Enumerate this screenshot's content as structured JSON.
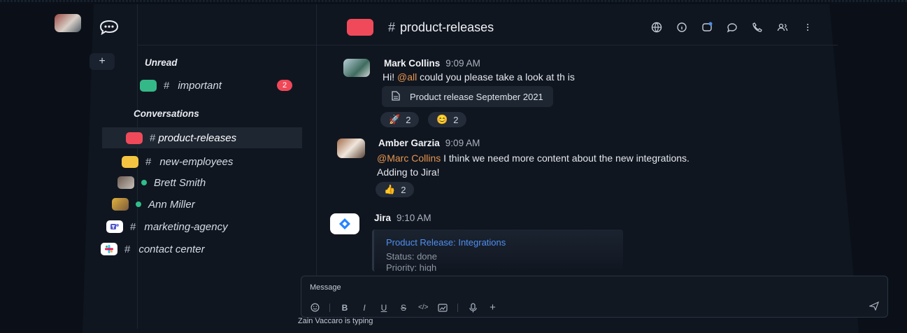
{
  "colors": {
    "accent_red": "#f04a5a",
    "accent_green": "#2fbf8a",
    "accent_yellow": "#f5c542",
    "mention": "#e7954d",
    "link_blue": "#4f8ff0"
  },
  "rail": {
    "logo_icon": "chat-bubble-icon",
    "add_label": "+"
  },
  "sidebar": {
    "unread_title": "Unread",
    "unread": [
      {
        "label": "important",
        "prefix": "#",
        "badge": "2",
        "color": "#35b887"
      }
    ],
    "conversations_title": "Conversations",
    "conversations": [
      {
        "label": "product-releases",
        "prefix": "#",
        "color": "#f04a5a",
        "active": true
      },
      {
        "label": "new-employees",
        "prefix": "#",
        "color": "#f5c542"
      },
      {
        "label": "Brett Smith",
        "status": "online"
      },
      {
        "label": "Ann Miller",
        "status": "online"
      },
      {
        "label": "marketing-agency",
        "prefix": "#",
        "icon": "teams-icon"
      },
      {
        "label": "contact center",
        "prefix": "#",
        "icon": "slack-icon"
      }
    ]
  },
  "header": {
    "channel_prefix": "#",
    "channel": "product-releases",
    "icons": [
      "globe-icon",
      "info-icon",
      "notification-icon",
      "discussion-icon",
      "phone-icon",
      "members-icon",
      "kebab-icon"
    ]
  },
  "messages": [
    {
      "author": "Mark Collins",
      "time": "9:09 AM",
      "text_before": "Hi! ",
      "mention": "@all",
      "text_after": " could you please take a look at th is",
      "file": "Product release September 2021",
      "reactions": [
        {
          "emoji": "🚀",
          "count": "2"
        },
        {
          "emoji": "😊",
          "count": "2"
        }
      ]
    },
    {
      "author": "Amber Garzia",
      "time": "9:09 AM",
      "mention": "@Marc Collins",
      "text_after": " I think we need more content about the new integrations.",
      "line2": "Adding to Jira!",
      "reactions": [
        {
          "emoji": "👍",
          "count": "2"
        }
      ]
    },
    {
      "author": "Jira",
      "time": "9:10 AM",
      "card_title": "Product Release: Integrations",
      "card_status": "Status: done",
      "card_priority": "Priority: high"
    }
  ],
  "composer": {
    "placeholder": "Message",
    "tools": [
      "emoji-icon",
      "bold",
      "italic",
      "underline",
      "strike",
      "code",
      "formatting",
      "mic-icon",
      "plus-icon"
    ],
    "bold": "B",
    "italic": "I",
    "underline": "U",
    "strike": "S",
    "code": "</>",
    "plus": "+",
    "typing": "Zain Vaccaro is typing"
  }
}
